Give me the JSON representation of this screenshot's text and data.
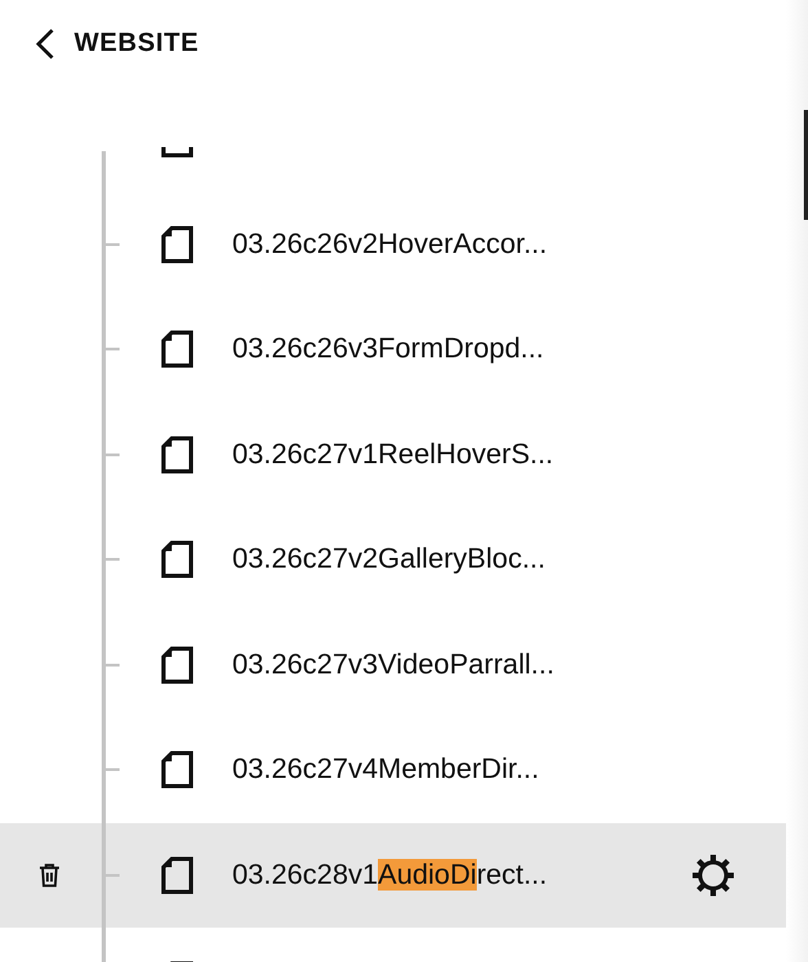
{
  "header": {
    "back_label": "WEBSITE"
  },
  "pages": [
    {
      "kind": "file"
    },
    {
      "kind": "file",
      "label": "03.26c26v2HoverAccor...",
      "selected": false
    },
    {
      "kind": "file",
      "label": "03.26c26v3FormDropd...",
      "selected": false
    },
    {
      "kind": "file",
      "label": "03.26c27v1ReelHoverS...",
      "selected": false
    },
    {
      "kind": "file",
      "label": "03.26c27v2GalleryBloc...",
      "selected": false
    },
    {
      "kind": "file",
      "label": "03.26c27v3VideoParrall...",
      "selected": false
    },
    {
      "kind": "file",
      "label": "03.26c27v4MemberDir...",
      "selected": false
    },
    {
      "kind": "file",
      "label": "03.26c28v1",
      "match": "AudioDi",
      "label_after": "rect...",
      "selected": true
    },
    {
      "kind": "file"
    }
  ]
}
